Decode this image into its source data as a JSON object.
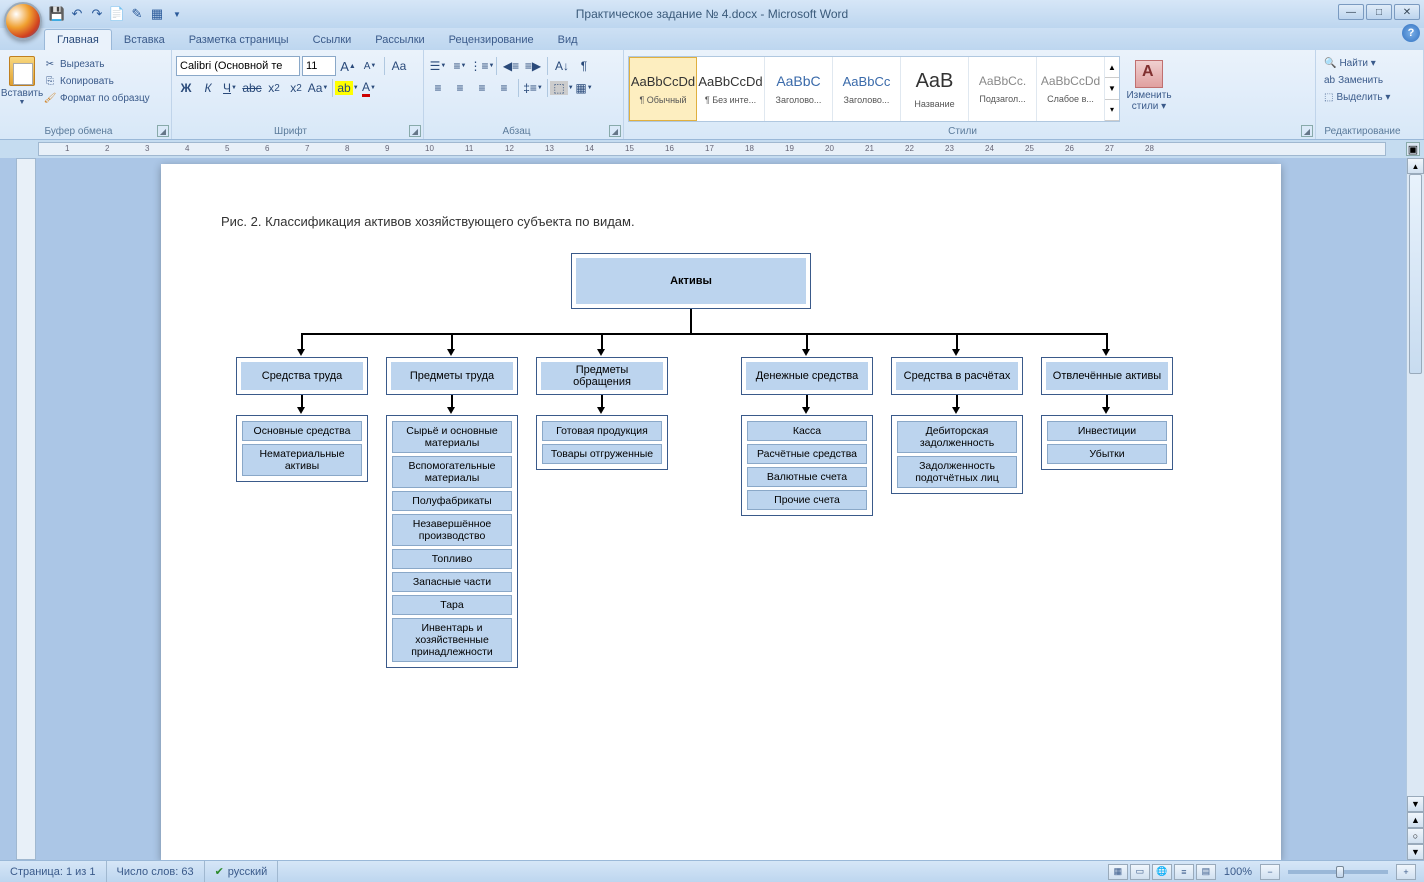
{
  "app": {
    "title": "Практическое задание № 4.docx - Microsoft Word"
  },
  "tabs": {
    "home": "Главная",
    "insert": "Вставка",
    "layout": "Разметка страницы",
    "refs": "Ссылки",
    "mail": "Рассылки",
    "review": "Рецензирование",
    "view": "Вид"
  },
  "clipboard": {
    "paste": "Вставить",
    "cut": "Вырезать",
    "copy": "Копировать",
    "painter": "Формат по образцу",
    "group": "Буфер обмена"
  },
  "font": {
    "name": "Calibri (Основной те",
    "size": "11",
    "group": "Шрифт"
  },
  "para": {
    "group": "Абзац"
  },
  "styles": {
    "group": "Стили",
    "change": "Изменить стили ▾",
    "items": [
      {
        "preview": "AaBbCcDd",
        "name": "¶ Обычный"
      },
      {
        "preview": "AaBbCcDd",
        "name": "¶ Без инте..."
      },
      {
        "preview": "AaBbC",
        "name": "Заголово..."
      },
      {
        "preview": "AaBbCc",
        "name": "Заголово..."
      },
      {
        "preview": "AaB",
        "name": "Название"
      },
      {
        "preview": "AaBbCc.",
        "name": "Подзагол..."
      },
      {
        "preview": "AaBbCcDd",
        "name": "Слабое в..."
      }
    ]
  },
  "editing": {
    "find": "Найти ▾",
    "replace": "Заменить",
    "select": "Выделить ▾",
    "group": "Редактирование"
  },
  "status": {
    "page": "Страница: 1 из 1",
    "words": "Число слов: 63",
    "lang": "русский",
    "zoom": "100%"
  },
  "doc": {
    "caption": "Рис. 2. Классификация активов хозяйствующего субъекта по видам.",
    "root": "Активы",
    "cols": [
      {
        "head": "Средства труда",
        "items": [
          "Основные средства",
          "Нематериальные активы"
        ]
      },
      {
        "head": "Предметы труда",
        "items": [
          "Сырьё и основные материалы",
          "Вспомогательные материалы",
          "Полуфабрикаты",
          "Незавершённое производство",
          "Топливо",
          "Запасные части",
          "Тара",
          "Инвентарь и хозяйственные принадлежности"
        ]
      },
      {
        "head": "Предметы обращения",
        "items": [
          "Готовая продукция",
          "Товары отгруженные"
        ]
      },
      {
        "head": "Денежные средства",
        "items": [
          "Касса",
          "Расчётные средства",
          "Валютные счета",
          "Прочие счета"
        ]
      },
      {
        "head": "Средства в расчётах",
        "items": [
          "Дебиторская задолженность",
          "Задолженность подотчётных лиц"
        ]
      },
      {
        "head": "Отвлечённые активы",
        "items": [
          "Инвестиции",
          "Убытки"
        ]
      }
    ]
  }
}
